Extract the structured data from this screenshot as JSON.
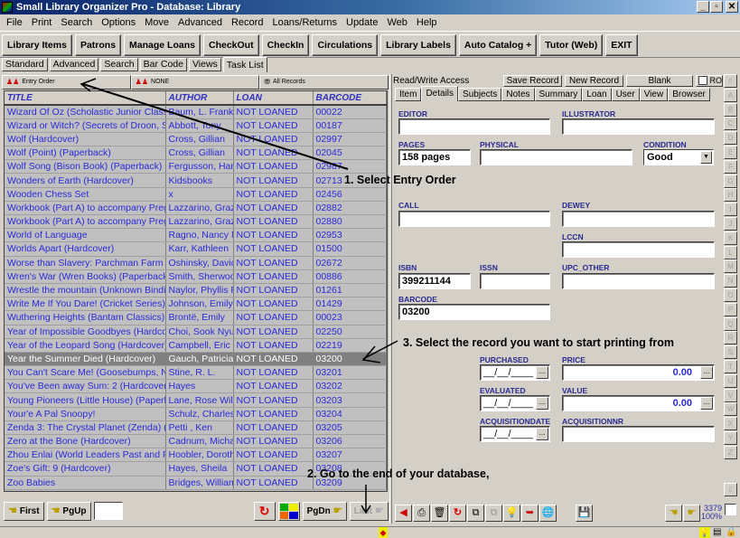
{
  "window": {
    "title": "Small Library Organizer Pro - Database: Library",
    "controls": {
      "minimize": "_",
      "restore": "▫",
      "close": "✕"
    }
  },
  "menu": [
    "File",
    "Print",
    "Search",
    "Options",
    "Move",
    "Advanced",
    "Record",
    "Loans/Returns",
    "Update",
    "Web",
    "Help"
  ],
  "toolbar": [
    "Library Items",
    "Patrons",
    "Manage Loans",
    "CheckOut",
    "CheckIn",
    "Circulations",
    "Library Labels",
    "Auto Catalog +",
    "Tutor (Web)",
    "EXIT"
  ],
  "search_tabs": {
    "items": [
      "Standard",
      "Advanced",
      "Search",
      "Bar Code",
      "Views",
      "Task List"
    ],
    "active": "Task List"
  },
  "sort_bar": {
    "order": "Entry Order",
    "secondary": "NONE",
    "filter": "All Records"
  },
  "grid": {
    "columns": [
      "TITLE",
      "AUTHOR",
      "LOAN",
      "BARCODE"
    ],
    "rows": [
      [
        "Wizard Of Oz (Scholastic Junior Classics)",
        "Baum, L. Frank",
        "NOT LOANED",
        "00022"
      ],
      [
        "Wizard or Witch? (Secrets of Droon, S",
        "Abbott, Tony",
        "NOT LOANED",
        "00187"
      ],
      [
        "Wolf (Hardcover)",
        "Cross, Gillian",
        "NOT LOANED",
        "02997"
      ],
      [
        "Wolf (Point) (Paperback)",
        "Cross, Gillian",
        "NOT LOANED",
        "02045"
      ],
      [
        "Wolf Song (Bison Book) (Paperback)",
        "Fergusson, Harvey",
        "NOT LOANED",
        "02987"
      ],
      [
        "Wonders of Earth (Hardcover)",
        "Kidsbooks",
        "NOT LOANED",
        "02713"
      ],
      [
        "Wooden Chess Set",
        "x",
        "NOT LOANED",
        "02456"
      ],
      [
        "Workbook (Part A) to accompany Prego",
        "Lazzarino, Graziana",
        "NOT LOANED",
        "02882"
      ],
      [
        "Workbook (Part A) to accompany Prego",
        "Lazzarino, Graziana",
        "NOT LOANED",
        "02880"
      ],
      [
        "World of Language",
        "Ragno, Nancy N",
        "NOT LOANED",
        "02953"
      ],
      [
        "Worlds Apart (Hardcover)",
        "Karr, Kathleen",
        "NOT LOANED",
        "01500"
      ],
      [
        "Worse than Slavery: Parchman Farm",
        "Oshinsky, David",
        "NOT LOANED",
        "02672"
      ],
      [
        "Wren's War (Wren Books) (Paperback)",
        "Smith, Sherwood",
        "NOT LOANED",
        "00886"
      ],
      [
        "Wrestle the mountain (Unknown Binding)",
        "Naylor, Phyllis R",
        "NOT LOANED",
        "01261"
      ],
      [
        "Write Me If You Dare! (Cricket Series)",
        "Johnson, Emily",
        "NOT LOANED",
        "01429"
      ],
      [
        "Wuthering Heights (Bantam Classics)",
        "Brontë, Emily",
        "NOT LOANED",
        "00023"
      ],
      [
        "Year of Impossible Goodbyes (Hardcover)",
        "Choi, Sook Nyul",
        "NOT LOANED",
        "02250"
      ],
      [
        "Year of the Leopard Song (Hardcover)",
        "Campbell, Eric",
        "NOT LOANED",
        "02219"
      ],
      [
        "Year the Summer Died (Hardcover)",
        "Gauch, Patricia",
        "NOT LOANED",
        "03200"
      ],
      [
        "You Can't Scare Me! (Goosebumps, No",
        "Stine, R. L.",
        "NOT LOANED",
        "03201"
      ],
      [
        "You've Been away Sum: 2 (Hardcover)",
        "Hayes",
        "NOT LOANED",
        "03202"
      ],
      [
        "Young Pioneers (Little House) (Paperback)",
        "Lane, Rose Wilder",
        "NOT LOANED",
        "03203"
      ],
      [
        "Your'e A Pal Snoopy!",
        "Schulz, Charles",
        "NOT LOANED",
        "03204"
      ],
      [
        "Zenda 3: The Crystal Planet (Zenda) (P",
        "Petti , Ken",
        "NOT LOANED",
        "03205"
      ],
      [
        "Zero at the Bone (Hardcover)",
        "Cadnum, Michael",
        "NOT LOANED",
        "03206"
      ],
      [
        "Zhou Enlai (World Leaders Past and Present)",
        "Hoobler, Dorothy",
        "NOT LOANED",
        "03207"
      ],
      [
        "Zoe's Gift: 9 (Hardcover)",
        "Hayes, Sheila",
        "NOT LOANED",
        "03208"
      ],
      [
        "Zoo Babies",
        "Bridges, William",
        "NOT LOANED",
        "03209"
      ]
    ],
    "selected_index": 18
  },
  "nav": {
    "first": "First",
    "pgup": "PgUp",
    "pgdn": "PgDn",
    "last": "Last",
    "goto_value": ""
  },
  "record": {
    "access": "Read/Write Access",
    "save": "Save Record",
    "new": "New Record",
    "blank": "Blank",
    "ro_label": "RO",
    "tabs": [
      "Item",
      "Details",
      "Subjects",
      "Notes",
      "Summary",
      "Loan",
      "User",
      "View",
      "Browser"
    ],
    "active_tab": "Details",
    "fields": {
      "editor": {
        "label": "EDITOR",
        "value": ""
      },
      "illustrator": {
        "label": "ILLUSTRATOR",
        "value": ""
      },
      "pages": {
        "label": "PAGES",
        "value": "158 pages"
      },
      "physical": {
        "label": "PHYSICAL",
        "value": ""
      },
      "condition": {
        "label": "CONDITION",
        "value": "Good"
      },
      "call": {
        "label": "CALL",
        "value": ""
      },
      "dewey": {
        "label": "DEWEY",
        "value": ""
      },
      "lccn": {
        "label": "LCCN",
        "value": ""
      },
      "isbn": {
        "label": "ISBN",
        "value": "399211144"
      },
      "issn": {
        "label": "ISSN",
        "value": ""
      },
      "upc_other": {
        "label": "UPC_OTHER",
        "value": ""
      },
      "barcode": {
        "label": "BARCODE",
        "value": "03200"
      },
      "purchased": {
        "label": "PURCHASED",
        "value": "__/__/____"
      },
      "price": {
        "label": "PRICE",
        "value": "0.00"
      },
      "evaluated": {
        "label": "EVALUATED",
        "value": "__/__/____"
      },
      "value": {
        "label": "VALUE",
        "value": "0.00"
      },
      "acquisitiondate": {
        "label": "ACQUISITIONDATE",
        "value": "__/__/____"
      },
      "acquisitionnr": {
        "label": "ACQUISITIONNR",
        "value": ""
      }
    },
    "dots": "..."
  },
  "alpha_index": [
    "A",
    "B",
    "C",
    "D",
    "E",
    "F",
    "G",
    "H",
    "I",
    "J",
    "K",
    "L",
    "M",
    "N",
    "O",
    "P",
    "Q",
    "R",
    "S",
    "T",
    "U",
    "V",
    "W",
    "X",
    "Y",
    "Z"
  ],
  "alpha_arrows": {
    "up": "⇧",
    "down": "⇩"
  },
  "record_counter": {
    "count": "3379",
    "zoom": "100%"
  },
  "annotations": {
    "step1": "1. Select Entry Order",
    "step2": "2. Go to the end of your database,",
    "step3": "3. Select the record you want to start printing from"
  }
}
